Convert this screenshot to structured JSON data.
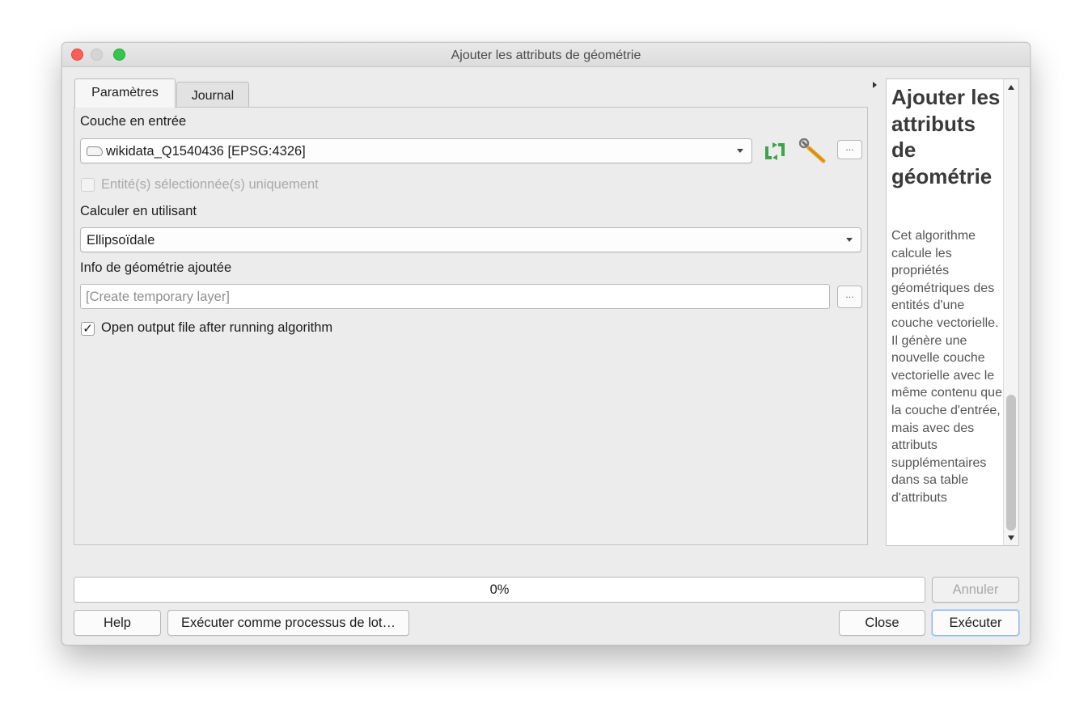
{
  "window": {
    "title": "Ajouter les attributs de géométrie"
  },
  "tabs": [
    {
      "label": "Paramètres",
      "active": true
    },
    {
      "label": "Journal",
      "active": false
    }
  ],
  "params": {
    "input_layer_label": "Couche en entrée",
    "input_layer_value": "wikidata_Q1540436 [EPSG:4326]",
    "selected_only_label": "Entité(s) sélectionnée(s) uniquement",
    "selected_only_checked": false,
    "calc_label": "Calculer en utilisant",
    "calc_value": "Ellipsoïdale",
    "output_label": "Info de géométrie ajoutée",
    "output_placeholder": "[Create temporary layer]",
    "open_output_label": "Open output file after running algorithm",
    "open_output_checked": true,
    "more_button": "…",
    "check_mark": "✓"
  },
  "help": {
    "title": "Ajouter les attributs de géométrie",
    "body": "Cet algorithme calcule les propriétés géométriques des entités d'une couche vectorielle. Il génère une nouvelle couche vectorielle avec le même contenu que la couche d'entrée, mais avec des attributs supplémentaires dans sa table d'attributs"
  },
  "progress": {
    "value": 0,
    "text": "0%"
  },
  "buttons": {
    "cancel": "Annuler",
    "help": "Help",
    "batch": "Exécuter comme processus de lot…",
    "close": "Close",
    "run": "Exécuter"
  },
  "colors": {
    "accent": "#4a90e2",
    "icon_green": "#3fa34d",
    "traffic_close": "#fc5f57",
    "traffic_max": "#34c84a"
  },
  "icons": {
    "iterate": "refresh-iterate-icon",
    "settings": "wrench-icon",
    "layer": "polygon-layer-icon"
  }
}
